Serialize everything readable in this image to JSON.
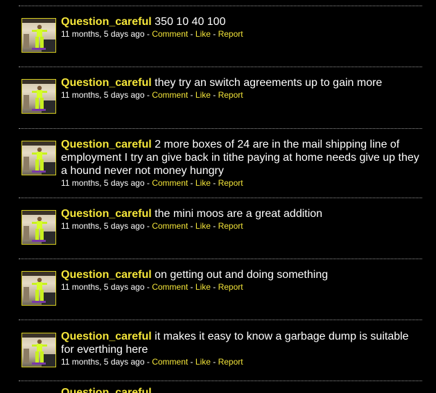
{
  "colors": {
    "background": "#000000",
    "username": "#f5e63a",
    "text": "#ffffff",
    "links": "#f5e63a",
    "divider": "#9a9a9a"
  },
  "separators": {
    "sep1": " - ",
    "sep2": " - ",
    "sep3": " - "
  },
  "comments": [
    {
      "username": "Question_careful",
      "text": "350 10 40 100",
      "time": "11 months, 5 days ago",
      "comment_label": "Comment",
      "like_label": "Like",
      "report_label": "Report"
    },
    {
      "username": "Question_careful",
      "text": "they try an switch agreements up to gain more",
      "time": "11 months, 5 days ago",
      "comment_label": "Comment",
      "like_label": "Like",
      "report_label": "Report"
    },
    {
      "username": "Question_careful",
      "text": "2 more boxes of 24 are in the mail shipping line of employment I try an give back in tithe paying at home needs give up they a hound never not money hungry",
      "time": "11 months, 5 days ago",
      "comment_label": "Comment",
      "like_label": "Like",
      "report_label": "Report"
    },
    {
      "username": "Question_careful",
      "text": "the mini moos are a great addition",
      "time": "11 months, 5 days ago",
      "comment_label": "Comment",
      "like_label": "Like",
      "report_label": "Report"
    },
    {
      "username": "Question_careful",
      "text": "on getting out and doing something",
      "time": "11 months, 5 days ago",
      "comment_label": "Comment",
      "like_label": "Like",
      "report_label": "Report"
    },
    {
      "username": "Question_careful",
      "text": "it makes it easy to know a garbage dump is suitable for everthing here",
      "time": "11 months, 5 days ago",
      "comment_label": "Comment",
      "like_label": "Like",
      "report_label": "Report"
    }
  ],
  "partial_entry": {
    "username": "Question_careful"
  }
}
